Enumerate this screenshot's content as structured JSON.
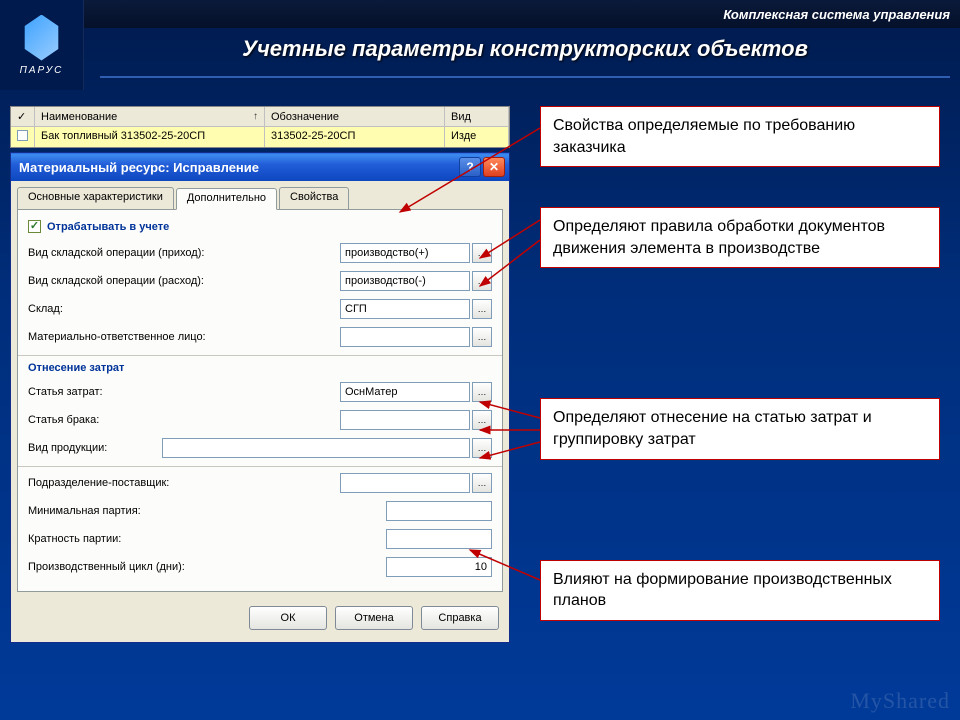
{
  "header": {
    "subtitle": "Комплексная система управления"
  },
  "logo": {
    "text": "ПАРУС"
  },
  "page_title": "Учетные параметры конструкторских объектов",
  "table": {
    "headers": {
      "name": "Наименование",
      "code": "Обозначение",
      "kind": "Вид"
    },
    "row": {
      "name": "Бак топливный 313502-25-20СП",
      "code": "313502-25-20СП",
      "kind": "Изде"
    }
  },
  "window": {
    "title": "Материальный ресурс: Исправление",
    "tabs": [
      "Основные характеристики",
      "Дополнительно",
      "Свойства"
    ],
    "active_tab": 1,
    "checkbox": "Отрабатывать в учете",
    "fields": {
      "op_in_label": "Вид складской операции (приход):",
      "op_in_value": "производство(+)",
      "op_out_label": "Вид складской операции (расход):",
      "op_out_value": "производство(-)",
      "store_label": "Склад:",
      "store_value": "СГП",
      "mol_label": "Материально-ответственное лицо:",
      "mol_value": ""
    },
    "group1_title": "Отнесение затрат",
    "group1": {
      "cost_item_label": "Статья затрат:",
      "cost_item_value": "ОснМатер",
      "defect_item_label": "Статья брака:",
      "defect_item_value": "",
      "product_kind_label": "Вид продукции:",
      "product_kind_value": ""
    },
    "group2": {
      "supplier_label": "Подразделение-поставщик:",
      "supplier_value": "",
      "min_batch_label": "Минимальная партия:",
      "min_batch_value": "",
      "mult_batch_label": "Кратность партии:",
      "mult_batch_value": "",
      "cycle_label": "Производственный цикл (дни):",
      "cycle_value": "10"
    },
    "buttons": {
      "ok": "ОК",
      "cancel": "Отмена",
      "help": "Справка"
    }
  },
  "callouts": [
    "Свойства определяемые по требованию заказчика",
    "Определяют правила обработки документов движения элемента в производстве",
    "Определяют отнесение на статью затрат и группировку затрат",
    "Влияют на формирование производственных планов"
  ],
  "watermark": "MyShared"
}
